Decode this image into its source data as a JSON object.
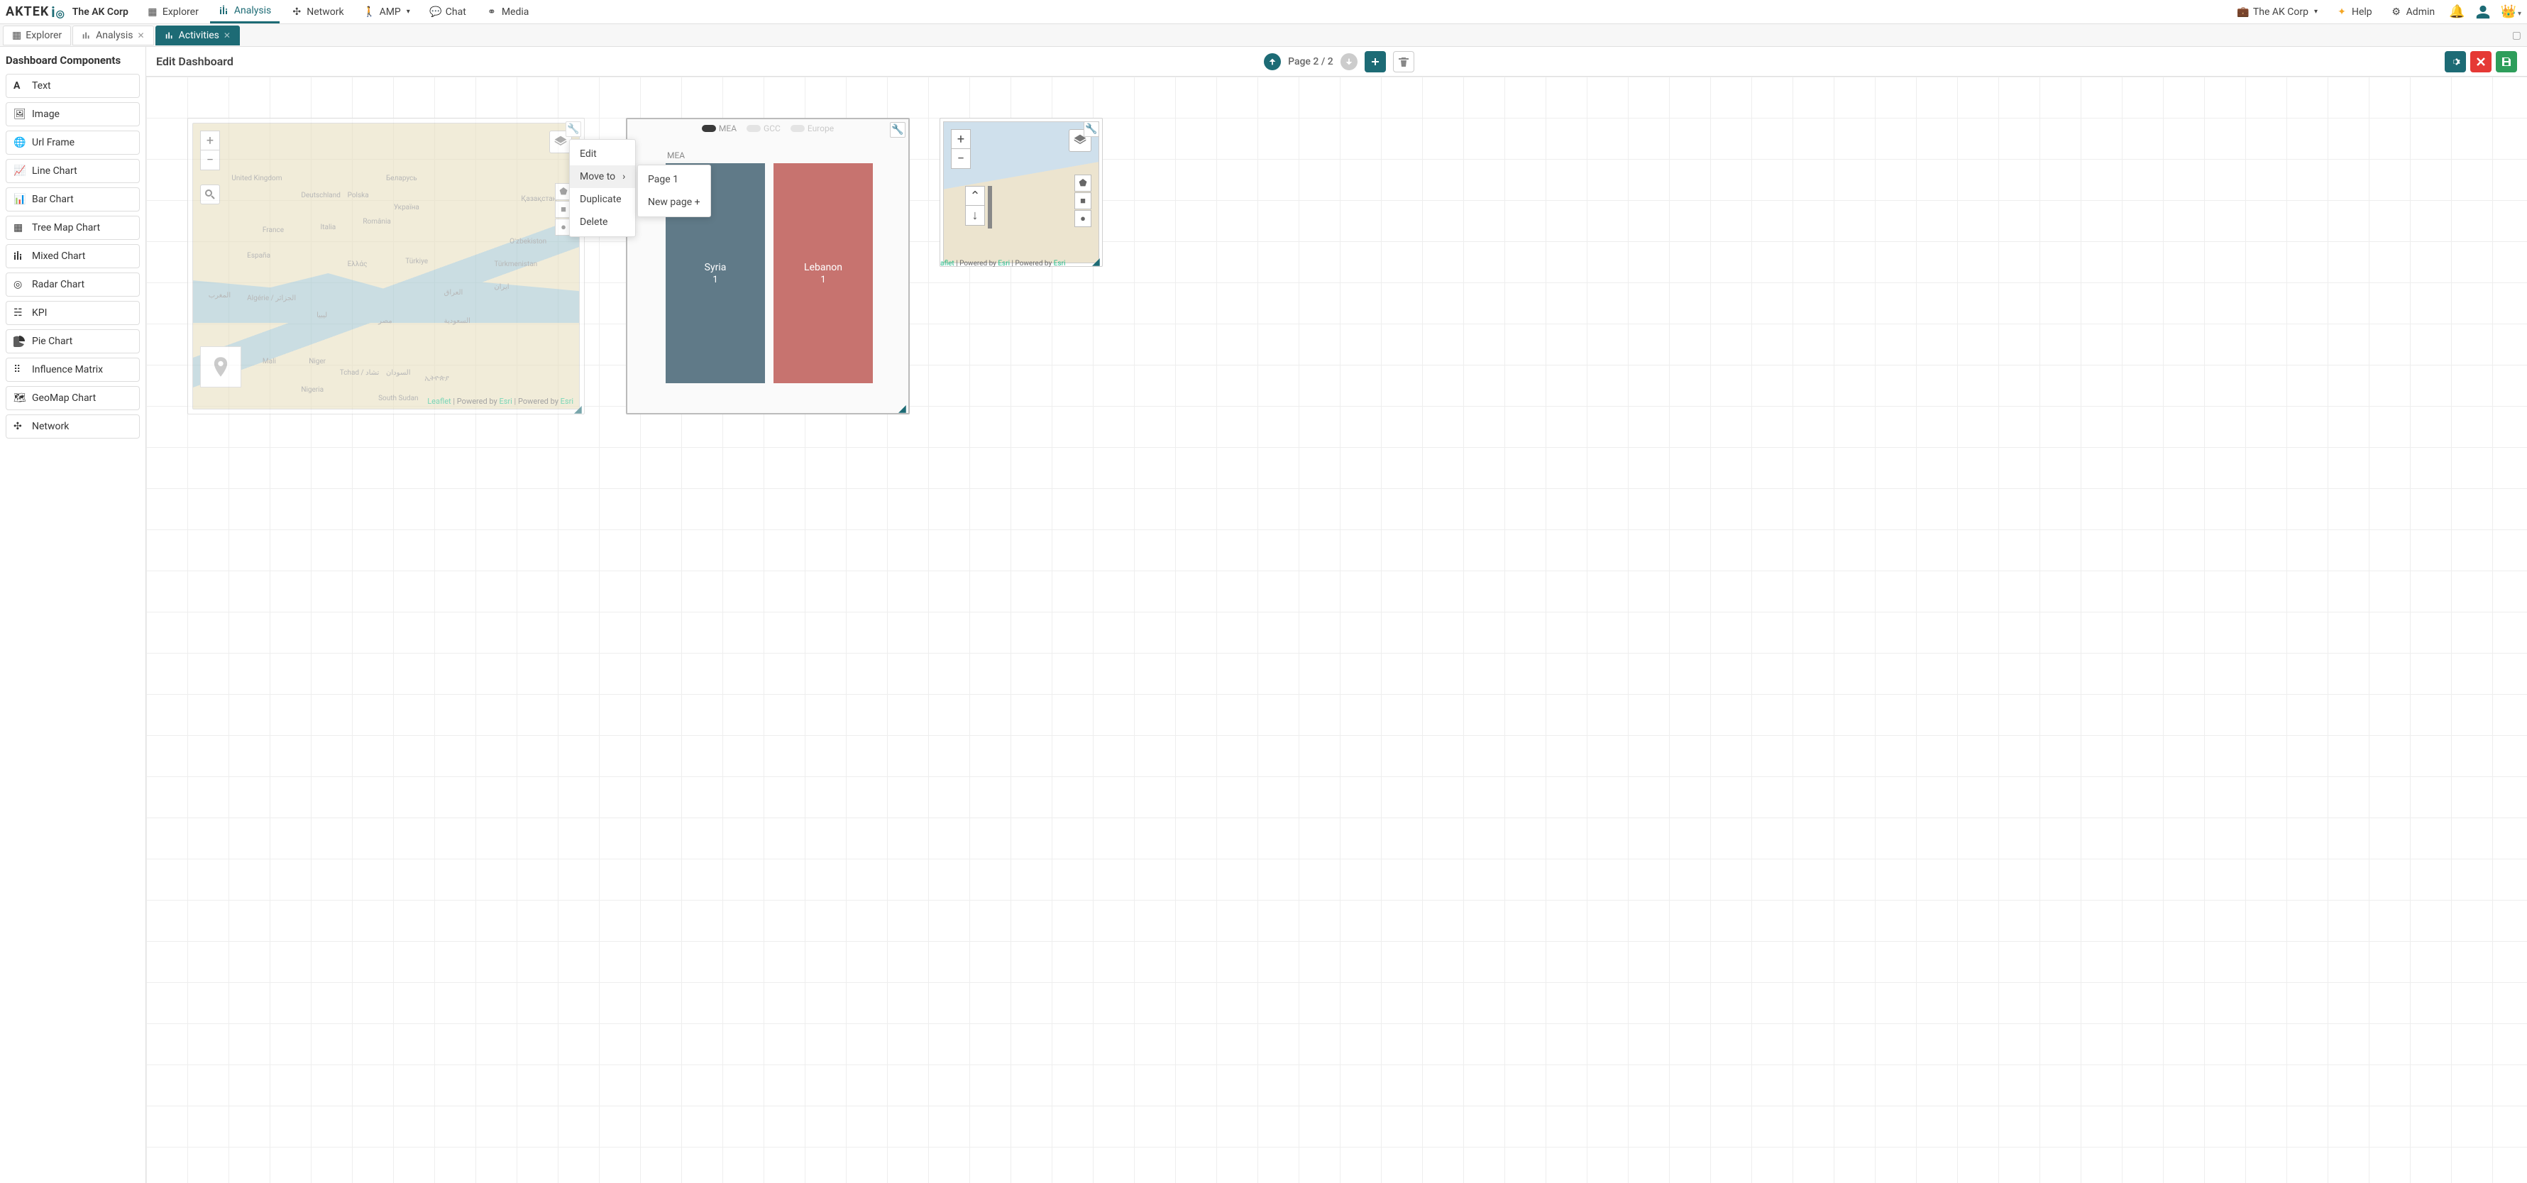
{
  "brand": {
    "logo_text": "AKTEK",
    "corp": "The AK Corp"
  },
  "nav": {
    "items": [
      {
        "label": "Explorer"
      },
      {
        "label": "Analysis"
      },
      {
        "label": "Network"
      },
      {
        "label": "AMP"
      },
      {
        "label": "Chat"
      },
      {
        "label": "Media"
      }
    ],
    "right_corp": "The AK Corp",
    "help": "Help",
    "admin": "Admin"
  },
  "tabs": [
    {
      "label": "Explorer",
      "closable": false
    },
    {
      "label": "Analysis",
      "closable": true
    },
    {
      "label": "Activities",
      "closable": true,
      "active": true
    }
  ],
  "sidebar": {
    "title": "Dashboard Components",
    "items": [
      {
        "label": "Text"
      },
      {
        "label": "Image"
      },
      {
        "label": "Url Frame"
      },
      {
        "label": "Line Chart"
      },
      {
        "label": "Bar Chart"
      },
      {
        "label": "Tree Map Chart"
      },
      {
        "label": "Mixed Chart"
      },
      {
        "label": "Radar Chart"
      },
      {
        "label": "KPI"
      },
      {
        "label": "Pie Chart"
      },
      {
        "label": "Influence Matrix"
      },
      {
        "label": "GeoMap Chart"
      },
      {
        "label": "Network"
      }
    ]
  },
  "editbar": {
    "title": "Edit Dashboard",
    "pager": "Page 2 / 2"
  },
  "map1": {
    "attrib_leaflet": "Leaflet",
    "attrib_mid1": " | Powered by ",
    "attrib_esri1": "Esri",
    "attrib_mid2": " | Powered by ",
    "attrib_esri2": "Esri",
    "labels": {
      "uk": "United Kingdom",
      "france": "France",
      "deutschland": "Deutschland",
      "espana": "España",
      "italia": "Italia",
      "polska": "Polska",
      "romania": "România",
      "turkiye": "Türkiye",
      "ukraine": "Україна",
      "belarus": "Беларусь",
      "greece": "Ελλάς",
      "kazakh": "Қазақстан",
      "ozbek": "Oʻzbekiston",
      "turkmen": "Türkmenistan",
      "iraq": "العراق",
      "iran": "ايران",
      "saudi": "السعودية",
      "egypt": "مصر",
      "libya": "ليبيا",
      "algerie": "Algérie / الجزائر",
      "maroc": "المغرب",
      "mali": "Mali",
      "niger": "Niger",
      "tchad": "Tchad / تشاد",
      "sudan": "السودان",
      "nigeria": "Nigeria",
      "ethiopia": "ኢትዮጵያ",
      "ssudan": "South Sudan"
    }
  },
  "map2": {
    "attrib_leaflet_trunc": "aflet",
    "attrib_mid1": " | Powered by ",
    "attrib_esri1": "Esri",
    "attrib_mid2": " | Powered by ",
    "attrib_esri2": "Esri"
  },
  "ctx_primary": {
    "edit": "Edit",
    "move_to": "Move to",
    "duplicate": "Duplicate",
    "delete": "Delete"
  },
  "ctx_sub": {
    "page1": "Page 1",
    "new_page": "New page +"
  },
  "chart_data": {
    "type": "treemap",
    "title": "",
    "category_label": "MEA",
    "legend": [
      {
        "name": "MEA",
        "color": "#3a3a3a",
        "active": true
      },
      {
        "name": "GCC",
        "color": "#cfcfcf",
        "active": false
      },
      {
        "name": "Europe",
        "color": "#cfcfcf",
        "active": false
      }
    ],
    "series": [
      {
        "name": "Syria",
        "value": 1,
        "color": "#607a88"
      },
      {
        "name": "Lebanon",
        "value": 1,
        "color": "#c7736f"
      }
    ]
  },
  "colors": {
    "teal": "#1d6b75",
    "red": "#e53935",
    "green": "#2e9e5b"
  }
}
